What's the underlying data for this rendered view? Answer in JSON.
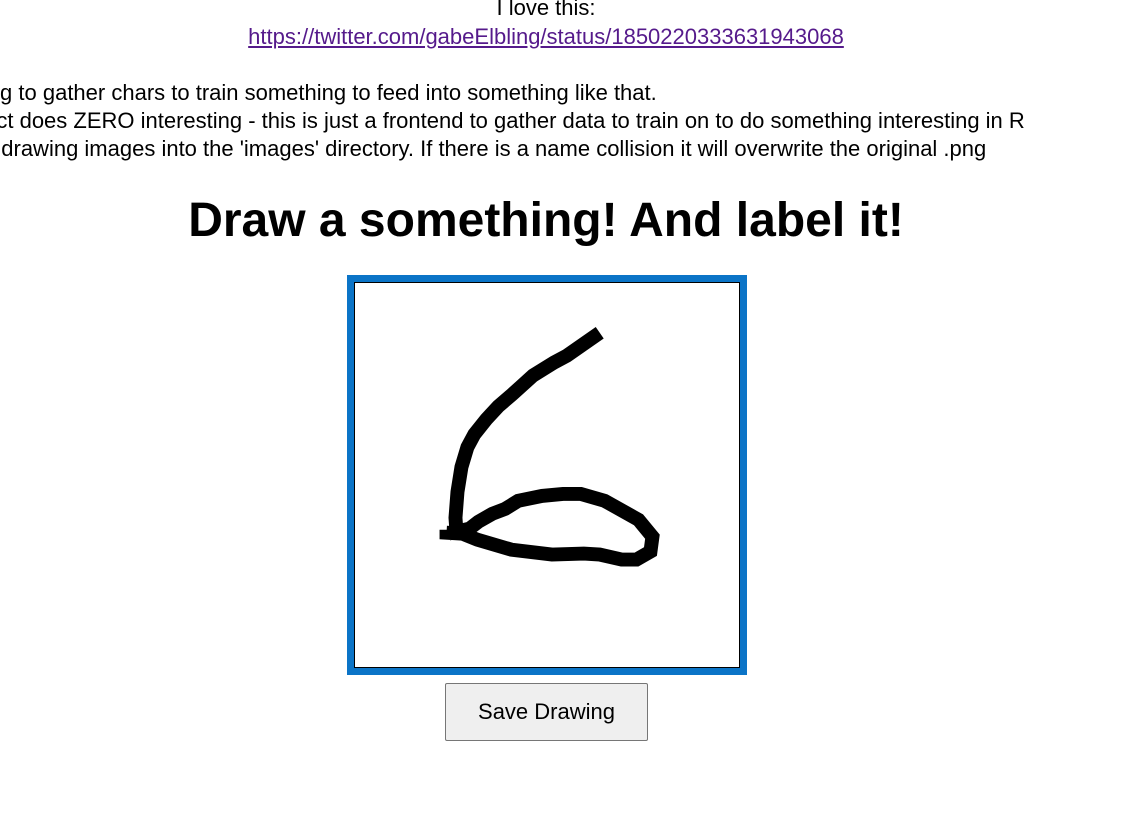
{
  "header": {
    "intro_text": "I love this:",
    "tweet_link": "https://twitter.com/gabeElbling/status/1850220333631943068"
  },
  "description": {
    "lines": [
      "A thing to gather chars to train something to feed into something like that.",
      "Project does ZERO interesting - this is just a frontend to gather data to train on to do something interesting in R",
      "Save drawing images into the 'images' directory. If there is a name collision it will overwrite the original .png"
    ]
  },
  "main": {
    "title": "Draw a something! And label it!",
    "save_button_label": "Save Drawing"
  },
  "colors": {
    "canvas_border": "#0b74c7",
    "link": "#551a8b",
    "stroke": "#000000"
  }
}
